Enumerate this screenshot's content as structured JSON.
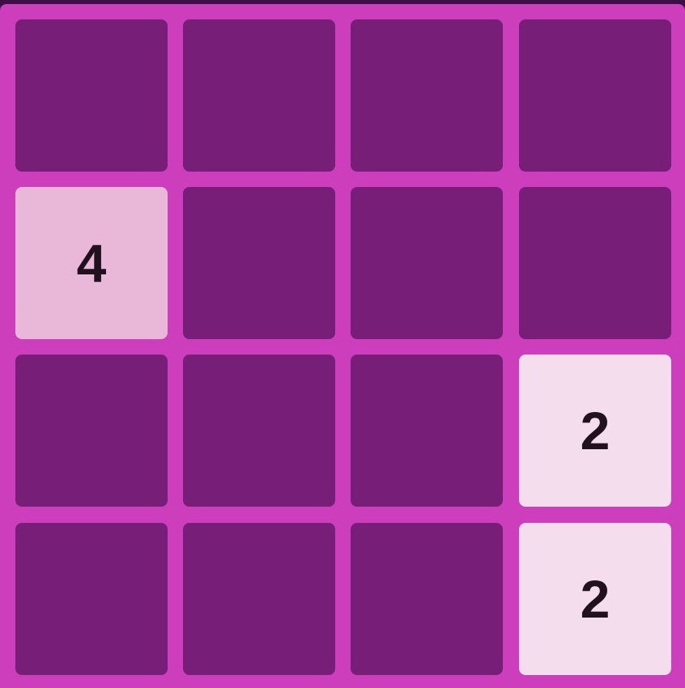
{
  "board": {
    "rows": 4,
    "cols": 4,
    "tiles": [
      {
        "row": 1,
        "col": 0,
        "value": "4",
        "color": "#e9b7d7"
      },
      {
        "row": 2,
        "col": 3,
        "value": "2",
        "color": "#f4deee"
      },
      {
        "row": 3,
        "col": 3,
        "value": "2",
        "color": "#f4deee"
      }
    ]
  },
  "colors": {
    "board_background": "#cc3ebb",
    "empty_cell": "#771e79",
    "tile_text": "#21111f"
  }
}
